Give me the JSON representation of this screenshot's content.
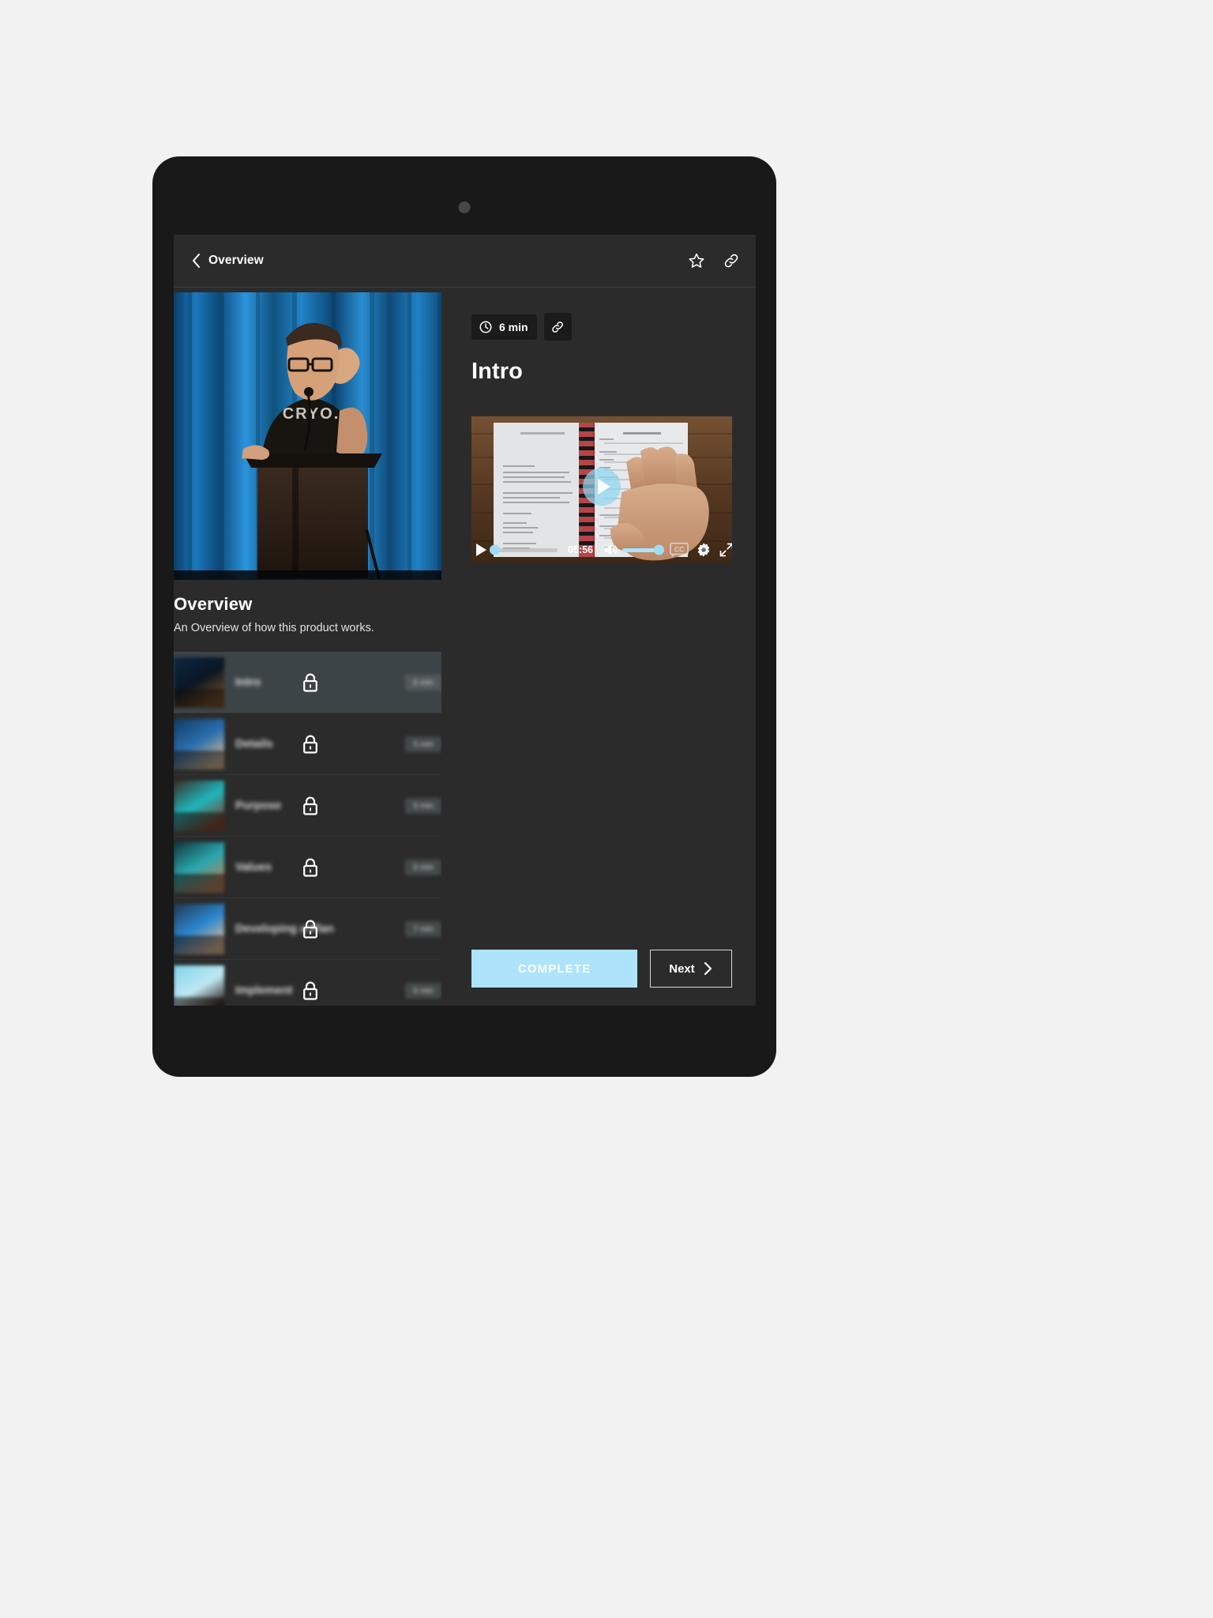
{
  "header": {
    "back_icon": "chevron-left-icon",
    "title": "Overview",
    "star_icon": "star-icon",
    "link_icon": "link-icon"
  },
  "left_panel": {
    "hero_image_alt": "speaker-at-podium-photo",
    "course_title": "Overview",
    "course_description": "An Overview of how this product works.",
    "lessons": [
      {
        "label": "Intro",
        "duration": "6 min",
        "locked": true,
        "active": true
      },
      {
        "label": "Details",
        "duration": "5 min",
        "locked": true,
        "active": false
      },
      {
        "label": "Purpose",
        "duration": "5 min",
        "locked": true,
        "active": false
      },
      {
        "label": "Values",
        "duration": "6 min",
        "locked": true,
        "active": false
      },
      {
        "label": "Developing a Plan",
        "duration": "7 min",
        "locked": true,
        "active": false
      },
      {
        "label": "Implement",
        "duration": "6 min",
        "locked": true,
        "active": false
      }
    ]
  },
  "right_panel": {
    "clock_icon": "clock-icon",
    "duration": "6 min",
    "link_icon": "link-icon",
    "lesson_title": "Intro",
    "video": {
      "poster_alt": "open-planner-notebook-on-desk",
      "play_overlay_icon": "play-circle-icon",
      "play_icon": "play-icon",
      "current_time": "05:56",
      "progress_percent": 0,
      "volume_percent": 100,
      "volume_icon": "volume-high-icon",
      "cc_icon": "closed-captions-icon",
      "settings_icon": "gear-icon",
      "fullscreen_icon": "fullscreen-icon"
    },
    "complete_label": "COMPLETE",
    "next_label": "Next",
    "next_icon": "chevron-right-icon"
  },
  "colors": {
    "page_background": "#f2f2f2",
    "bezel": "#191919",
    "app_background": "#2b2b2b",
    "accent": "#ade4fb",
    "active_row": "#3d4447"
  }
}
